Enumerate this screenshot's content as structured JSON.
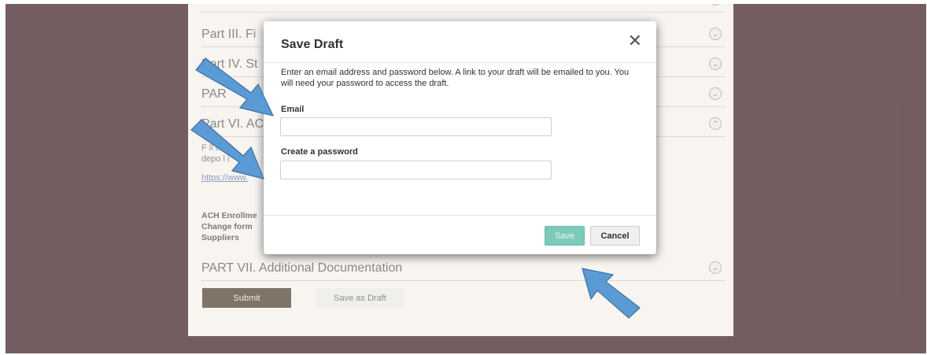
{
  "form": {
    "rows": [
      {
        "title": "Part III. Fi",
        "expanded": false
      },
      {
        "title": "Part IV. St",
        "expanded": false
      },
      {
        "title": "PAR",
        "expanded": false
      },
      {
        "title": "Part VI. AC",
        "expanded": true
      },
      {
        "title": "PART VII. Additional Documentation",
        "expanded": false
      }
    ],
    "section_text_1": "F     ll out",
    "section_text_2": "depo      l i",
    "section_link": "https://www.",
    "doc_line_1": "ACH Enrollme",
    "doc_line_2": "Change form",
    "doc_line_3": "Suppliers",
    "submit_label": "Submit",
    "save_draft_label": "Save as Draft"
  },
  "modal": {
    "title": "Save Draft",
    "close_glyph": "✕",
    "intro": "Enter an email address and password below. A link to your draft will be emailed to you. You will need your password to access the draft.",
    "email_label": "Email",
    "email_value": "",
    "password_label": "Create a password",
    "password_value": "",
    "save_label": "Save",
    "cancel_label": "Cancel"
  },
  "colors": {
    "backdrop": "#2a070b",
    "panel": "#f4eee6",
    "save_button": "#7ccab9",
    "submit_button": "#3b2a18",
    "arrow_fill": "#5b9bd5"
  }
}
